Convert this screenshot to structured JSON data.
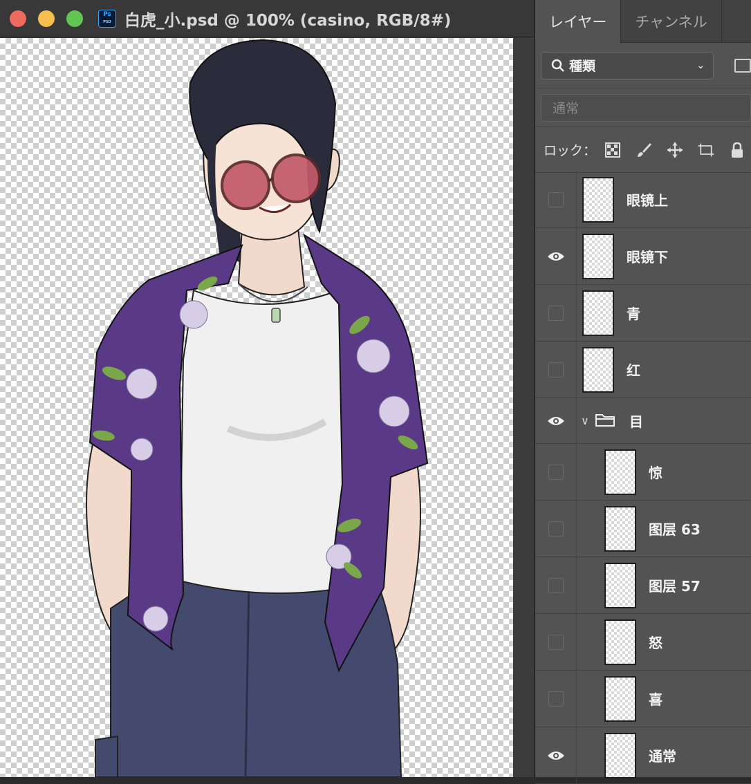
{
  "window": {
    "file_title": "白虎_小.psd @ 100% (casino, RGB/8#)",
    "app_icon": "ps-icon",
    "app_icon_text": "Ps",
    "app_icon_subtext": "PSD"
  },
  "panel": {
    "tabs": [
      {
        "label": "レイヤー",
        "active": true
      },
      {
        "label": "チャンネル",
        "active": false
      }
    ],
    "filter": {
      "icon": "search-icon",
      "label": "種類"
    },
    "blend_mode": "通常",
    "lock_label": "ロック：",
    "lock_icons": [
      "lock-transparent-pixels-icon",
      "lock-image-pixels-icon",
      "lock-position-icon",
      "lock-artboard-icon",
      "lock-all-icon"
    ]
  },
  "layers": [
    {
      "name": "眼镜上",
      "visible": false,
      "indent": false
    },
    {
      "name": "眼镜下",
      "visible": true,
      "indent": false
    },
    {
      "name": "青",
      "visible": false,
      "indent": false
    },
    {
      "name": "红",
      "visible": false,
      "indent": false
    },
    {
      "name": "目",
      "visible": true,
      "group": true,
      "expanded": true
    },
    {
      "name": "惊",
      "visible": false,
      "indent": true
    },
    {
      "name": "图层 63",
      "visible": false,
      "indent": true
    },
    {
      "name": "图层 57",
      "visible": false,
      "indent": true
    },
    {
      "name": "怒",
      "visible": false,
      "indent": true
    },
    {
      "name": "喜",
      "visible": false,
      "indent": true
    },
    {
      "name": "通常",
      "visible": true,
      "indent": true
    }
  ],
  "colors": {
    "close": "#ed6a5e",
    "minimize": "#f5bf4f",
    "zoom": "#61c554",
    "shirt": "#5a3a86",
    "pants": "#434a6e",
    "hair": "#2a2c3c",
    "glasses": "#c25a6a"
  }
}
